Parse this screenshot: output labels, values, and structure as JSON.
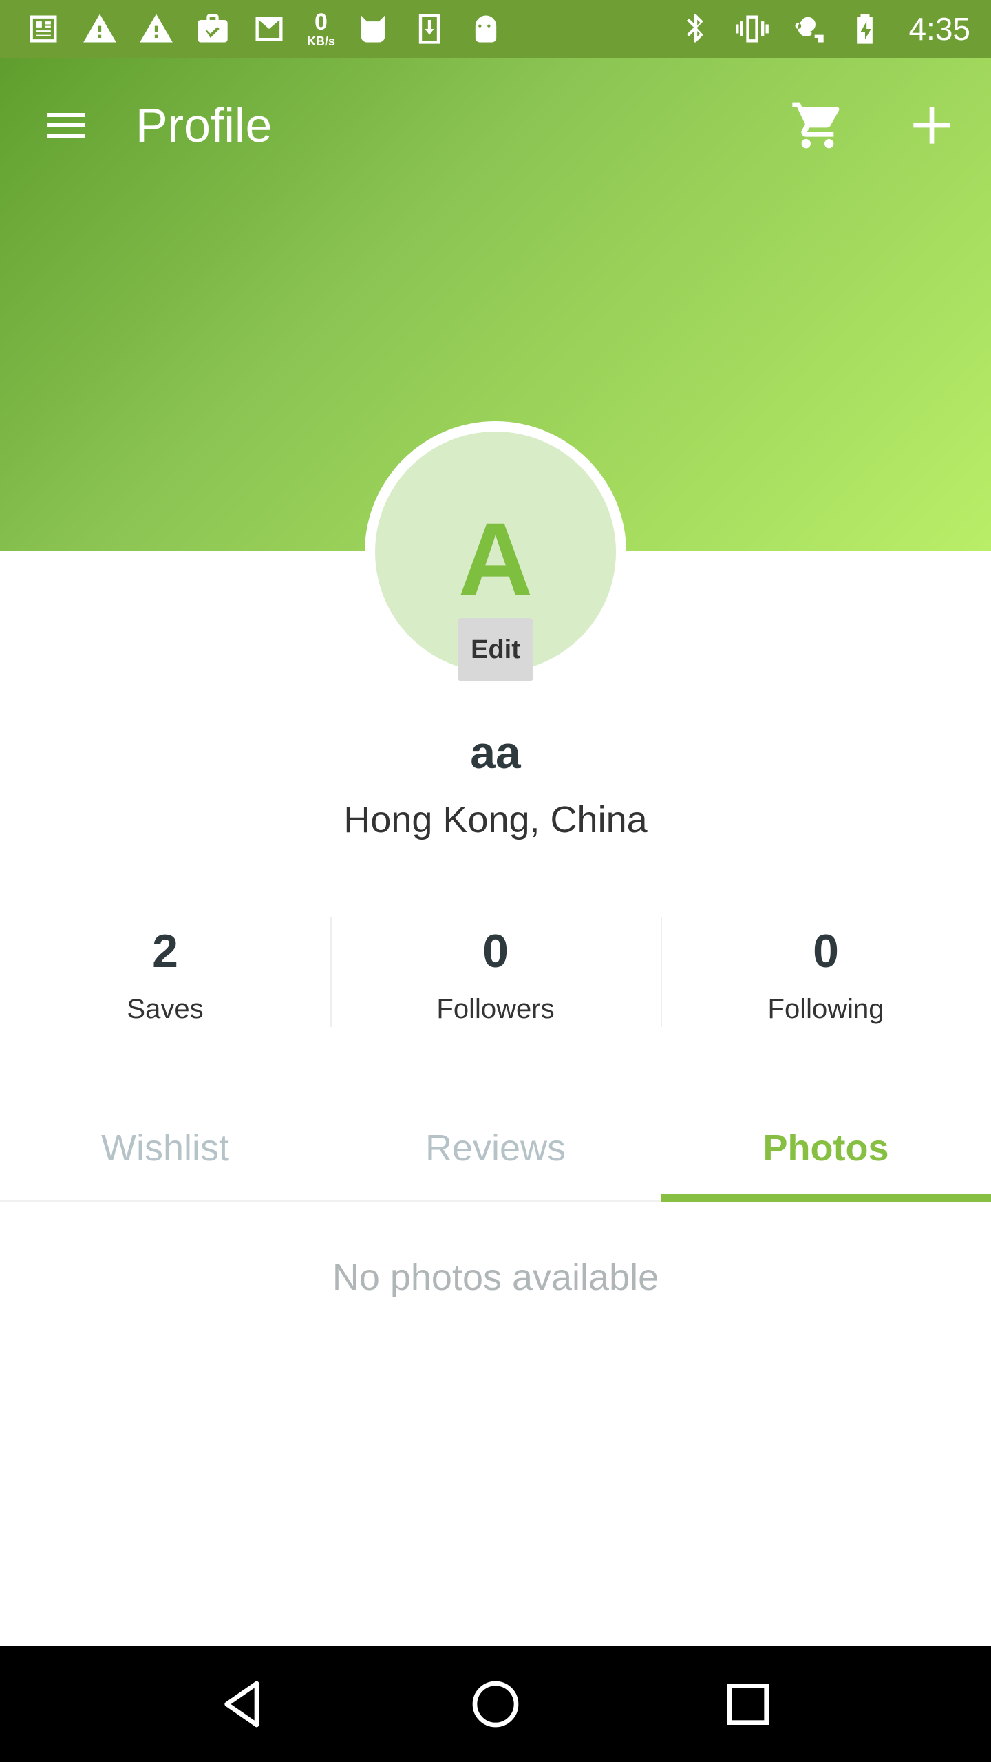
{
  "status_bar": {
    "time": "4:35",
    "speed_value": "0",
    "speed_unit": "KB/s",
    "icons": [
      "news-icon",
      "warning-icon",
      "warning-icon",
      "briefcase-check-icon",
      "mail-icon",
      "network-speed",
      "cat-icon",
      "download-icon",
      "android-icon",
      "bluetooth-icon",
      "vibrate-icon",
      "key-icon",
      "battery-charging-icon"
    ]
  },
  "toolbar": {
    "title": "Profile",
    "icons": [
      "menu-icon",
      "cart-icon",
      "add-icon"
    ]
  },
  "profile": {
    "avatar_letter": "A",
    "edit_label": "Edit",
    "username": "aa",
    "location": "Hong Kong, China"
  },
  "stats": [
    {
      "value": "2",
      "label": "Saves"
    },
    {
      "value": "0",
      "label": "Followers"
    },
    {
      "value": "0",
      "label": "Following"
    }
  ],
  "tabs": [
    {
      "label": "Wishlist",
      "active": false
    },
    {
      "label": "Reviews",
      "active": false
    },
    {
      "label": "Photos",
      "active": true
    }
  ],
  "content": {
    "empty_message": "No photos available"
  },
  "nav": {
    "icons": [
      "back-icon",
      "home-icon",
      "recents-icon"
    ]
  },
  "colors": {
    "accent": "#86bf42",
    "status_bar": "#6f9f34",
    "header_gradient_start": "#5f9e2e",
    "header_gradient_end": "#b9ee68",
    "avatar_bg": "#d9ecc8"
  }
}
